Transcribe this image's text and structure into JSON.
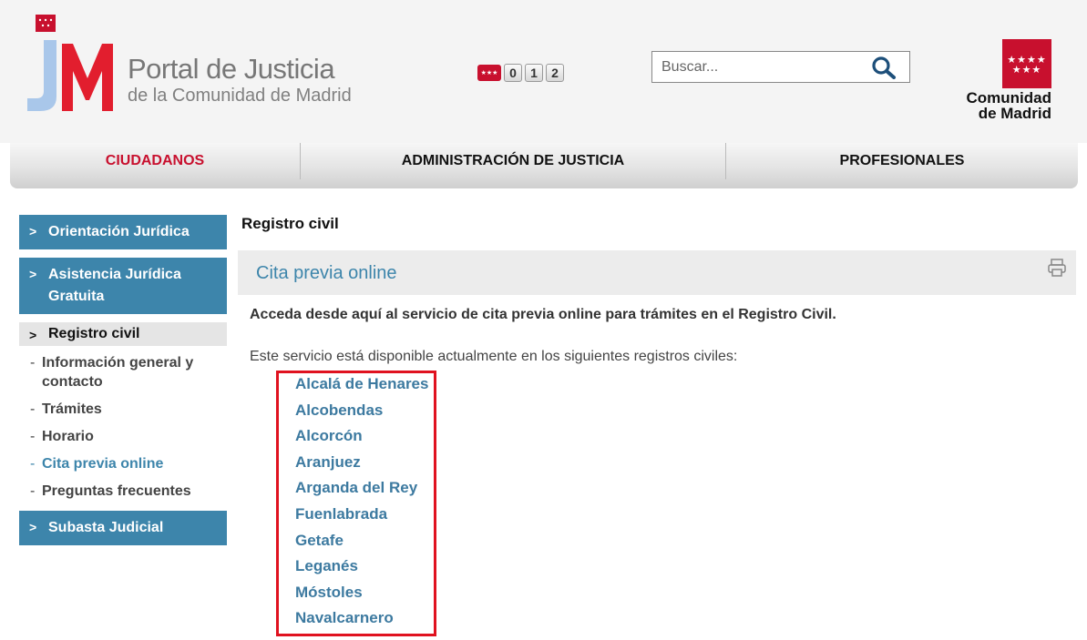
{
  "header": {
    "logo_title": "Portal de Justicia",
    "logo_subtitle": "de la Comunidad de Madrid",
    "emergency_digits": [
      "0",
      "1",
      "2"
    ],
    "search": {
      "placeholder": "Buscar..."
    },
    "region_logo_line1": "Comunidad",
    "region_logo_line2": "de Madrid"
  },
  "colors": {
    "accent": "#3d85ab",
    "brand_red": "#c8102e",
    "highlight": "#e0121f"
  },
  "nav": [
    {
      "label": "CIUDADANOS",
      "active": true
    },
    {
      "label": "ADMINISTRACIÓN DE JUSTICIA",
      "active": false
    },
    {
      "label": "PROFESIONALES",
      "active": false
    }
  ],
  "sidebar": {
    "chevron": ">",
    "sections_top": [
      {
        "label": "Orientación Jurídica"
      },
      {
        "label": "Asistencia Jurídica Gratuita"
      }
    ],
    "current": {
      "label": "Registro civil"
    },
    "sub_items": [
      {
        "label": "Información general y contacto",
        "current": false
      },
      {
        "label": "Trámites",
        "current": false
      },
      {
        "label": "Horario",
        "current": false
      },
      {
        "label": "Cita previa online",
        "current": true
      },
      {
        "label": "Preguntas frecuentes",
        "current": false
      }
    ],
    "sections_bottom": [
      {
        "label": "Subasta Judicial"
      }
    ]
  },
  "content": {
    "page_title": "Registro civil",
    "section_title": "Cita previa online",
    "lead": "Acceda desde aquí al servicio de cita previa online para trámites en el Registro Civil.",
    "available_text": "Este servicio está disponible actualmente en los siguientes registros civiles:",
    "registries": [
      "Alcalá de Henares",
      "Alcobendas",
      "Alcorcón",
      "Aranjuez",
      "Arganda del Rey",
      "Fuenlabrada",
      "Getafe",
      "Leganés",
      "Móstoles",
      "Navalcarnero"
    ]
  }
}
